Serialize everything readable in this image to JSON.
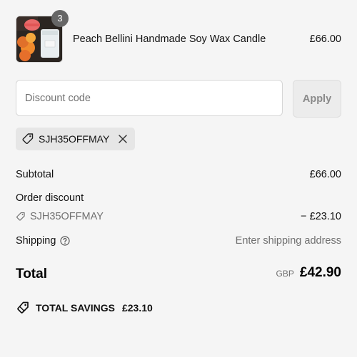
{
  "product": {
    "name": "Peach Bellini Handmade Soy Wax Candle",
    "price": "£66.00",
    "quantity": "3"
  },
  "discount_form": {
    "placeholder": "Discount code",
    "apply_label": "Apply"
  },
  "applied_code": {
    "code": "SJH35OFFMAY"
  },
  "summary": {
    "subtotal_label": "Subtotal",
    "subtotal_value": "£66.00",
    "order_discount_label": "Order discount",
    "discount_code": "SJH35OFFMAY",
    "discount_value": "− £23.10",
    "shipping_label": "Shipping",
    "shipping_value": "Enter shipping address",
    "total_label": "Total",
    "currency": "GBP",
    "total_value": "£42.90",
    "savings_label": "TOTAL SAVINGS",
    "savings_value": "£23.10"
  },
  "icons": {
    "tag": "tag-icon",
    "close": "close-icon",
    "help": "question-circle-icon",
    "savings": "savings-tag-icon"
  },
  "colors": {
    "background": "#f5f5f5",
    "badge": "#666666",
    "chip": "#e6e6e6",
    "muted_text": "#707070"
  }
}
